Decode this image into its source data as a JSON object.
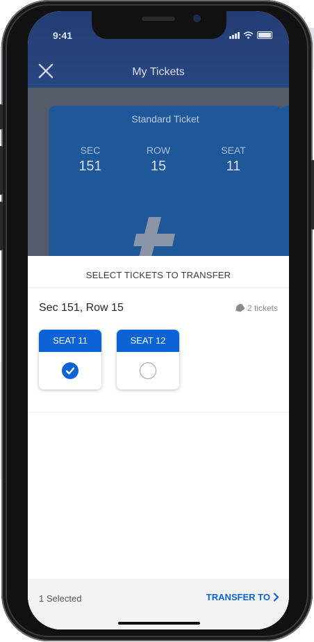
{
  "status": {
    "time": "9:41"
  },
  "header": {
    "title": "My Tickets"
  },
  "ticket": {
    "type": "Standard Ticket",
    "fields": [
      {
        "label": "SEC",
        "value": "151"
      },
      {
        "label": "ROW",
        "value": "15"
      },
      {
        "label": "SEAT",
        "value": "11"
      }
    ]
  },
  "sheet": {
    "title": "SELECT TICKETS TO TRANSFER",
    "section_label": "Sec 151, Row 15",
    "tickets_count": "2 tickets",
    "seats": [
      {
        "label": "SEAT 11",
        "selected": true
      },
      {
        "label": "SEAT 12",
        "selected": false
      }
    ]
  },
  "footer": {
    "selected_text": "1 Selected",
    "transfer_label": "TRANSFER TO"
  },
  "colors": {
    "accent": "#0c63d8",
    "ticket_blue": "#1e5899",
    "header_blue": "#2a4a85"
  }
}
